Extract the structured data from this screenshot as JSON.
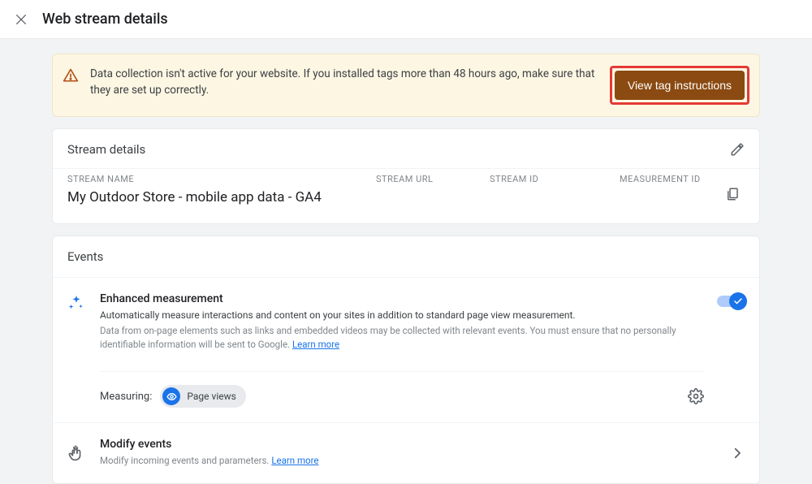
{
  "topbar": {
    "title": "Web stream details"
  },
  "alert": {
    "text": "Data collection isn't active for your website. If you installed tags more than 48 hours ago, make sure that they are set up correctly.",
    "button": "View tag instructions"
  },
  "stream_details": {
    "header": "Stream details",
    "labels": {
      "name": "STREAM NAME",
      "url": "STREAM URL",
      "id": "STREAM ID",
      "measurement": "MEASUREMENT ID"
    },
    "values": {
      "name": "My Outdoor Store - mobile app data - GA4",
      "url": "",
      "id": "",
      "measurement": ""
    }
  },
  "events": {
    "header": "Events",
    "enhanced": {
      "title": "Enhanced measurement",
      "subtitle": "Automatically measure interactions and content on your sites in addition to standard page view measurement.",
      "desc_prefix": "Data from on-page elements such as links and embedded videos may be collected with relevant events. You must ensure that no personally identifiable information will be sent to Google. ",
      "learn": "Learn more",
      "measuring_label": "Measuring:",
      "chip": "Page views"
    },
    "modify": {
      "title": "Modify events",
      "desc_prefix": "Modify incoming events and parameters. ",
      "learn": "Learn more"
    }
  }
}
